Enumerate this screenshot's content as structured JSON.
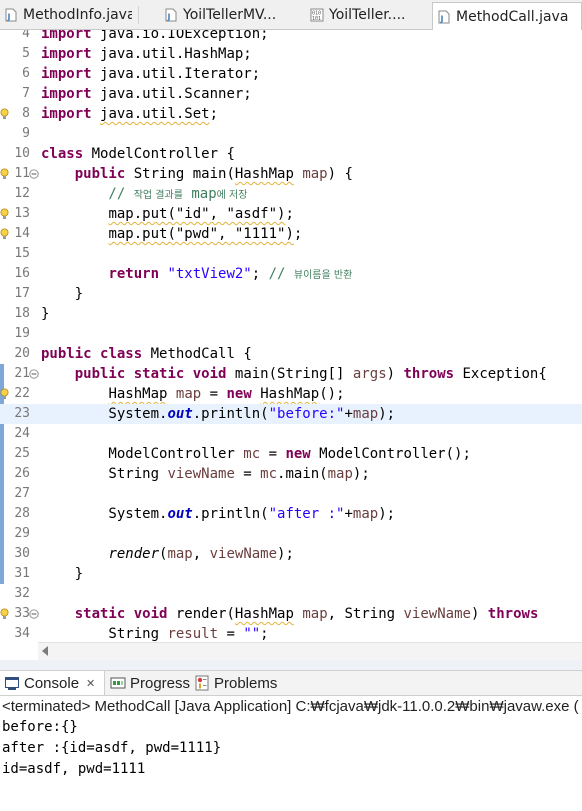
{
  "editor_tabs": [
    {
      "label": "MethodInfo.java",
      "active": false
    },
    {
      "label": "YoilTellerMV...",
      "active": false
    },
    {
      "label": "YoilTeller....",
      "active": false
    },
    {
      "label": "MethodCall.java",
      "active": true
    }
  ],
  "editor": {
    "current_line": 23,
    "lines": [
      {
        "n": "4",
        "tokens": [
          {
            "t": "import",
            "c": "kw"
          },
          {
            "t": " java.io.IOException;",
            "c": ""
          }
        ]
      },
      {
        "n": "5",
        "tokens": [
          {
            "t": "import",
            "c": "kw"
          },
          {
            "t": " java.util.HashMap;",
            "c": ""
          }
        ]
      },
      {
        "n": "6",
        "tokens": [
          {
            "t": "import",
            "c": "kw"
          },
          {
            "t": " java.util.Iterator;",
            "c": ""
          }
        ]
      },
      {
        "n": "7",
        "tokens": [
          {
            "t": "import",
            "c": "kw"
          },
          {
            "t": " java.util.Scanner;",
            "c": ""
          }
        ]
      },
      {
        "n": "8",
        "warn": true,
        "tokens": [
          {
            "t": "import",
            "c": "kw"
          },
          {
            "t": " ",
            "c": ""
          },
          {
            "t": "java.util.Set",
            "c": "uline"
          },
          {
            "t": ";",
            "c": ""
          }
        ]
      },
      {
        "n": "9",
        "tokens": []
      },
      {
        "n": "10",
        "tokens": [
          {
            "t": "class",
            "c": "kw"
          },
          {
            "t": " ModelController {",
            "c": ""
          }
        ]
      },
      {
        "n": "11",
        "warn": true,
        "fold": true,
        "tokens": [
          {
            "t": "    ",
            "c": ""
          },
          {
            "t": "public",
            "c": "kw"
          },
          {
            "t": " String main(",
            "c": ""
          },
          {
            "t": "HashMap",
            "c": "uline"
          },
          {
            "t": " ",
            "c": ""
          },
          {
            "t": "map",
            "c": "var"
          },
          {
            "t": ") {",
            "c": ""
          }
        ]
      },
      {
        "n": "12",
        "tokens": [
          {
            "t": "        // ",
            "c": "cmt"
          },
          {
            "t": "작업 결과를",
            "c": "cmt cmt-k"
          },
          {
            "t": " map",
            "c": "cmt"
          },
          {
            "t": "에 저장",
            "c": "cmt cmt-k"
          }
        ]
      },
      {
        "n": "13",
        "warn": true,
        "tokens": [
          {
            "t": "        ",
            "c": ""
          },
          {
            "t": "map.put(\"id\", \"asdf\")",
            "c": "uline"
          },
          {
            "t": ";",
            "c": ""
          }
        ]
      },
      {
        "n": "14",
        "warn": true,
        "tokens": [
          {
            "t": "        ",
            "c": ""
          },
          {
            "t": "map.put(\"pwd\", \"1111\")",
            "c": "uline"
          },
          {
            "t": ";",
            "c": ""
          }
        ]
      },
      {
        "n": "15",
        "tokens": []
      },
      {
        "n": "16",
        "tokens": [
          {
            "t": "        ",
            "c": ""
          },
          {
            "t": "return",
            "c": "kw"
          },
          {
            "t": " ",
            "c": ""
          },
          {
            "t": "\"txtView2\"",
            "c": "str"
          },
          {
            "t": "; ",
            "c": ""
          },
          {
            "t": "// ",
            "c": "cmt"
          },
          {
            "t": "뷰이름을 반환",
            "c": "cmt cmt-k"
          }
        ]
      },
      {
        "n": "17",
        "tokens": [
          {
            "t": "    }",
            "c": ""
          }
        ]
      },
      {
        "n": "18",
        "tokens": [
          {
            "t": "}",
            "c": ""
          }
        ]
      },
      {
        "n": "19",
        "tokens": []
      },
      {
        "n": "20",
        "tokens": [
          {
            "t": "public",
            "c": "kw"
          },
          {
            "t": " ",
            "c": ""
          },
          {
            "t": "class",
            "c": "kw"
          },
          {
            "t": " MethodCall {",
            "c": ""
          }
        ]
      },
      {
        "n": "21",
        "fold": true,
        "tokens": [
          {
            "t": "    ",
            "c": ""
          },
          {
            "t": "public",
            "c": "kw"
          },
          {
            "t": " ",
            "c": ""
          },
          {
            "t": "static",
            "c": "kw"
          },
          {
            "t": " ",
            "c": ""
          },
          {
            "t": "void",
            "c": "kw"
          },
          {
            "t": " main(String[] ",
            "c": ""
          },
          {
            "t": "args",
            "c": "var"
          },
          {
            "t": ") ",
            "c": ""
          },
          {
            "t": "throws",
            "c": "kw"
          },
          {
            "t": " Exception{",
            "c": ""
          }
        ]
      },
      {
        "n": "22",
        "warn": true,
        "tokens": [
          {
            "t": "        ",
            "c": ""
          },
          {
            "t": "HashMap",
            "c": "uline"
          },
          {
            "t": " ",
            "c": ""
          },
          {
            "t": "map",
            "c": "var"
          },
          {
            "t": " = ",
            "c": ""
          },
          {
            "t": "new",
            "c": "kw"
          },
          {
            "t": " ",
            "c": ""
          },
          {
            "t": "HashMap",
            "c": "uline"
          },
          {
            "t": "();",
            "c": ""
          }
        ]
      },
      {
        "n": "23",
        "tokens": [
          {
            "t": "        System.",
            "c": ""
          },
          {
            "t": "out",
            "c": "fld"
          },
          {
            "t": ".println(",
            "c": ""
          },
          {
            "t": "\"before:\"",
            "c": "str"
          },
          {
            "t": "+",
            "c": ""
          },
          {
            "t": "map",
            "c": "var"
          },
          {
            "t": ");",
            "c": ""
          }
        ]
      },
      {
        "n": "24",
        "tokens": []
      },
      {
        "n": "25",
        "tokens": [
          {
            "t": "        ModelController ",
            "c": ""
          },
          {
            "t": "mc",
            "c": "var"
          },
          {
            "t": " = ",
            "c": ""
          },
          {
            "t": "new",
            "c": "kw"
          },
          {
            "t": " ModelController();",
            "c": ""
          }
        ]
      },
      {
        "n": "26",
        "tokens": [
          {
            "t": "        String ",
            "c": ""
          },
          {
            "t": "viewName",
            "c": "var"
          },
          {
            "t": " = ",
            "c": ""
          },
          {
            "t": "mc",
            "c": "var"
          },
          {
            "t": ".main(",
            "c": ""
          },
          {
            "t": "map",
            "c": "var"
          },
          {
            "t": ");",
            "c": ""
          }
        ]
      },
      {
        "n": "27",
        "tokens": []
      },
      {
        "n": "28",
        "tokens": [
          {
            "t": "        System.",
            "c": ""
          },
          {
            "t": "out",
            "c": "fld"
          },
          {
            "t": ".println(",
            "c": ""
          },
          {
            "t": "\"after :\"",
            "c": "str"
          },
          {
            "t": "+",
            "c": ""
          },
          {
            "t": "map",
            "c": "var"
          },
          {
            "t": ");",
            "c": ""
          }
        ]
      },
      {
        "n": "29",
        "tokens": []
      },
      {
        "n": "30",
        "tokens": [
          {
            "t": "        ",
            "c": ""
          },
          {
            "t": "render",
            "c": "itl"
          },
          {
            "t": "(",
            "c": ""
          },
          {
            "t": "map",
            "c": "var"
          },
          {
            "t": ", ",
            "c": ""
          },
          {
            "t": "viewName",
            "c": "var"
          },
          {
            "t": ");",
            "c": ""
          }
        ]
      },
      {
        "n": "31",
        "tokens": [
          {
            "t": "    }",
            "c": ""
          }
        ]
      },
      {
        "n": "32",
        "tokens": []
      },
      {
        "n": "33",
        "warn": true,
        "fold": true,
        "tokens": [
          {
            "t": "    ",
            "c": ""
          },
          {
            "t": "static",
            "c": "kw"
          },
          {
            "t": " ",
            "c": ""
          },
          {
            "t": "void",
            "c": "kw"
          },
          {
            "t": " render(",
            "c": ""
          },
          {
            "t": "HashMap",
            "c": "uline"
          },
          {
            "t": " ",
            "c": ""
          },
          {
            "t": "map",
            "c": "var"
          },
          {
            "t": ", String ",
            "c": ""
          },
          {
            "t": "viewName",
            "c": "var"
          },
          {
            "t": ") ",
            "c": ""
          },
          {
            "t": "throws",
            "c": "kw"
          }
        ]
      },
      {
        "n": "34",
        "tokens": [
          {
            "t": "        String ",
            "c": ""
          },
          {
            "t": "result",
            "c": "var"
          },
          {
            "t": " = ",
            "c": ""
          },
          {
            "t": "\"\"",
            "c": "str"
          },
          {
            "t": ";",
            "c": ""
          }
        ]
      }
    ]
  },
  "views": {
    "console": {
      "label": "Console",
      "close": "✕"
    },
    "progress": {
      "label": "Progress"
    },
    "problems": {
      "label": "Problems"
    }
  },
  "console": {
    "header": "<terminated> MethodCall [Java Application] C:₩fcjava₩jdk-11.0.0.2₩bin₩javaw.exe  (",
    "output": [
      "before:{}",
      "after :{id=asdf, pwd=1111}",
      "id=asdf, pwd=1111"
    ]
  },
  "colors": {
    "keyword": "#7f0055",
    "string": "#2a00ff",
    "comment": "#3f7f5f",
    "local_var": "#6a3e3e",
    "static_field": "#0000c0",
    "current_line_bg": "#e8f2fe"
  },
  "icons": {
    "java_file": "java-file-icon",
    "java_file_alt": "java-file-binary-icon",
    "warning": "warning-lightbulb-icon",
    "fold": "fold-collapse-icon",
    "console": "console-icon",
    "progress": "progress-icon",
    "problems": "problems-icon"
  }
}
